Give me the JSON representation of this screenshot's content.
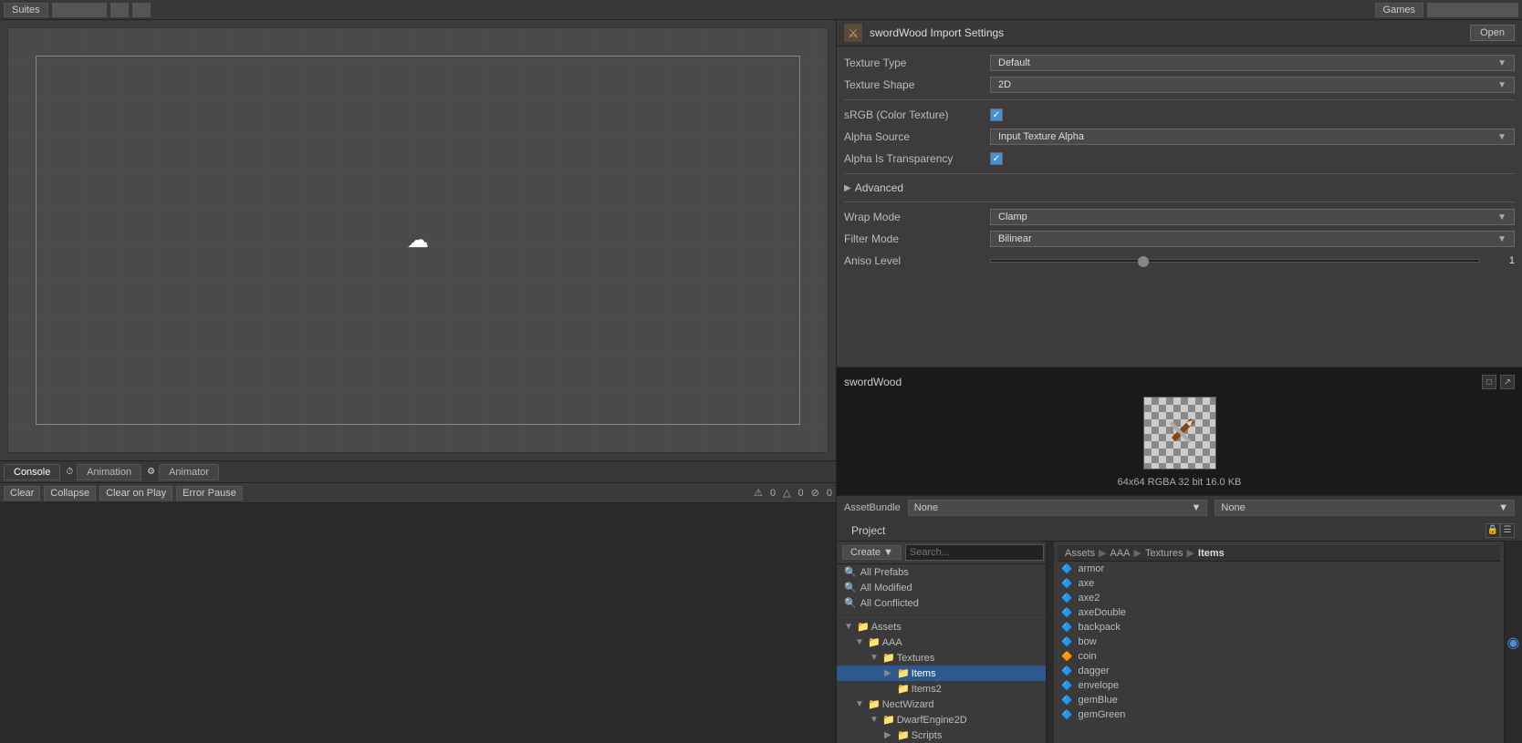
{
  "topbar": {
    "items": [
      "Suites",
      "Games"
    ]
  },
  "inspector": {
    "title": "swordWood Import Settings",
    "open_btn": "Open",
    "properties": {
      "texture_type_label": "Texture Type",
      "texture_type_value": "Default",
      "texture_shape_label": "Texture Shape",
      "texture_shape_value": "2D",
      "srgb_label": "sRGB (Color Texture)",
      "alpha_source_label": "Alpha Source",
      "alpha_source_value": "Input Texture Alpha",
      "alpha_transparency_label": "Alpha Is Transparency",
      "advanced_label": "Advanced",
      "wrap_mode_label": "Wrap Mode",
      "wrap_mode_value": "Clamp",
      "filter_mode_label": "Filter Mode",
      "filter_mode_value": "Bilinear",
      "aniso_level_label": "Aniso Level",
      "aniso_level_value": "1"
    }
  },
  "preview": {
    "title": "swordWood",
    "info": "64x64  RGBA 32 bit  16.0 KB"
  },
  "assetbundle": {
    "label": "AssetBundle",
    "value1": "None",
    "value2": "None"
  },
  "console": {
    "tabs": [
      "Console",
      "Animation",
      "Animator"
    ],
    "active_tab": "Console",
    "buttons": {
      "clear": "Clear",
      "collapse": "Collapse",
      "clear_on_play": "Clear on Play",
      "error_pause": "Error Pause"
    },
    "status": {
      "warning_count": "0",
      "error_count": "0",
      "info_count": "0"
    }
  },
  "project": {
    "tab_label": "Project",
    "create_btn": "Create",
    "filters": [
      {
        "label": "All Prefabs",
        "icon": "🔍"
      },
      {
        "label": "All Modified",
        "icon": "🔍"
      },
      {
        "label": "All Conflicted",
        "icon": "🔍"
      }
    ],
    "tree": [
      {
        "label": "Assets",
        "level": 0,
        "expanded": true,
        "is_folder": true
      },
      {
        "label": "AAA",
        "level": 1,
        "expanded": true,
        "is_folder": true
      },
      {
        "label": "Textures",
        "level": 2,
        "expanded": true,
        "is_folder": true
      },
      {
        "label": "Items",
        "level": 3,
        "expanded": false,
        "is_folder": true,
        "selected": true
      },
      {
        "label": "Items2",
        "level": 3,
        "expanded": false,
        "is_folder": true
      },
      {
        "label": "NectWizard",
        "level": 1,
        "expanded": true,
        "is_folder": true
      },
      {
        "label": "DwarfEngine2D",
        "level": 2,
        "expanded": true,
        "is_folder": true
      },
      {
        "label": "Scripts",
        "level": 3,
        "expanded": false,
        "is_folder": true
      }
    ],
    "breadcrumb": [
      "Assets",
      "AAA",
      "Textures",
      "Items"
    ],
    "files": [
      "armor",
      "axe",
      "axe2",
      "axeDouble",
      "backpack",
      "bow",
      "coin",
      "dagger",
      "envelope",
      "gemBlue",
      "gemGreen"
    ]
  }
}
